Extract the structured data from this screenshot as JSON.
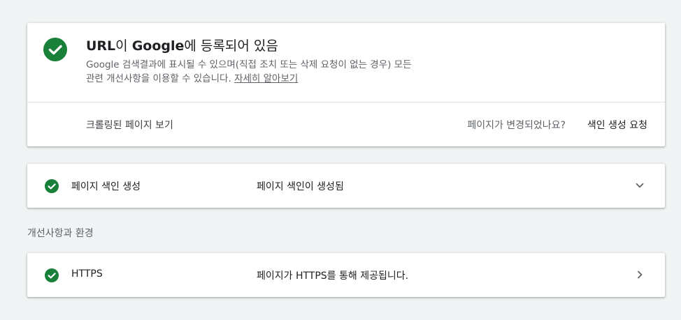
{
  "status_card": {
    "title_prefix": "URL",
    "title_particle": "이 ",
    "title_brand": "Google",
    "title_suffix": "에 등록되어 있음",
    "description_line1": "Google 검색결과에 표시될 수 있으며(직접 조치 또는 삭제 요청이 없는 경우) 모든",
    "description_line2": "관련 개선사항을 이용할 수 있습니다.",
    "learn_more": "자세히 알아보기",
    "crawled_page_link": "크롤링된 페이지 보기",
    "page_changed_question": "페이지가 변경되었나요?",
    "request_indexing": "색인 생성 요청",
    "icon": "check-circle-icon"
  },
  "indexing_row": {
    "label": "페이지 색인 생성",
    "value": "페이지 색인이 생성됨",
    "icon": "check-circle-icon",
    "action_icon": "chevron-down-icon"
  },
  "enhancements_heading": "개선사항과 환경",
  "https_row": {
    "label": "HTTPS",
    "value": "페이지가 HTTPS를 통해 제공됩니다.",
    "icon": "check-circle-icon",
    "action_icon": "chevron-right-icon"
  },
  "colors": {
    "success_green": "#188038",
    "background": "#f1f3f4",
    "card": "#ffffff",
    "secondary_text": "#5f6368"
  }
}
